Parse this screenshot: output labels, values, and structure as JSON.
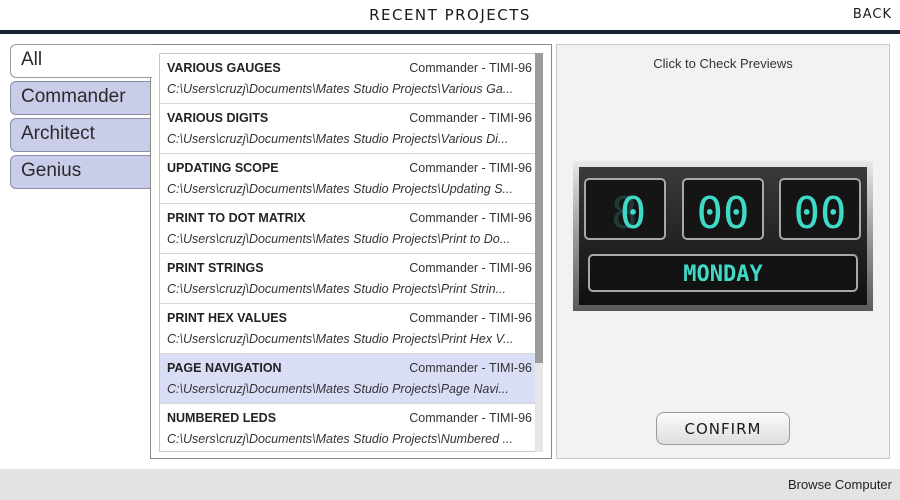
{
  "header": {
    "title": "RECENT PROJECTS",
    "back_label": "BACK"
  },
  "tabs": [
    {
      "label": "All",
      "active": true
    },
    {
      "label": "Commander",
      "active": false
    },
    {
      "label": "Architect",
      "active": false
    },
    {
      "label": "Genius",
      "active": false
    }
  ],
  "projects": [
    {
      "name": "VARIOUS GAUGES",
      "device": "Commander - TIMI-96",
      "path": "C:\\Users\\cruzj\\Documents\\Mates Studio Projects\\Various Ga..."
    },
    {
      "name": "VARIOUS DIGITS",
      "device": "Commander - TIMI-96",
      "path": "C:\\Users\\cruzj\\Documents\\Mates Studio Projects\\Various Di..."
    },
    {
      "name": "UPDATING SCOPE",
      "device": "Commander - TIMI-96",
      "path": "C:\\Users\\cruzj\\Documents\\Mates Studio Projects\\Updating S..."
    },
    {
      "name": "PRINT TO DOT MATRIX",
      "device": "Commander - TIMI-96",
      "path": "C:\\Users\\cruzj\\Documents\\Mates Studio Projects\\Print to Do..."
    },
    {
      "name": "PRINT STRINGS",
      "device": "Commander - TIMI-96",
      "path": "C:\\Users\\cruzj\\Documents\\Mates Studio Projects\\Print Strin..."
    },
    {
      "name": "PRINT HEX VALUES",
      "device": "Commander - TIMI-96",
      "path": "C:\\Users\\cruzj\\Documents\\Mates Studio Projects\\Print Hex V..."
    },
    {
      "name": "PAGE NAVIGATION",
      "device": "Commander - TIMI-96",
      "path": "C:\\Users\\cruzj\\Documents\\Mates Studio Projects\\Page Navi...",
      "selected": true
    },
    {
      "name": "NUMBERED LEDS",
      "device": "Commander - TIMI-96",
      "path": "C:\\Users\\cruzj\\Documents\\Mates Studio Projects\\Numbered ..."
    }
  ],
  "preview": {
    "hint": "Click to Check Previews",
    "digits": [
      "0",
      "00",
      "00"
    ],
    "day": "MONDAY",
    "confirm_label": "CONFIRM",
    "accent": "#3fd9c8"
  },
  "footer": {
    "browse_label": "Browse Computer"
  }
}
